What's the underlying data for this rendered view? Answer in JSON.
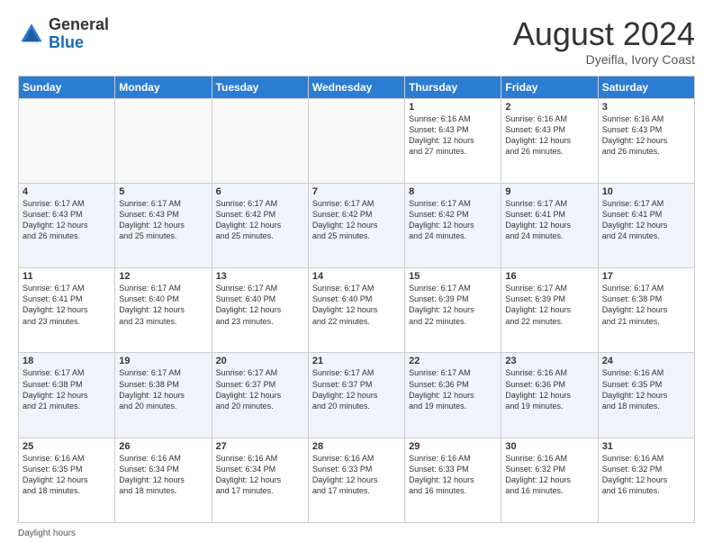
{
  "logo": {
    "line1": "General",
    "line2": "Blue"
  },
  "title": "August 2024",
  "subtitle": "Dyeifla, Ivory Coast",
  "days_of_week": [
    "Sunday",
    "Monday",
    "Tuesday",
    "Wednesday",
    "Thursday",
    "Friday",
    "Saturday"
  ],
  "weeks": [
    [
      {
        "day": "",
        "info": ""
      },
      {
        "day": "",
        "info": ""
      },
      {
        "day": "",
        "info": ""
      },
      {
        "day": "",
        "info": ""
      },
      {
        "day": "1",
        "info": "Sunrise: 6:16 AM\nSunset: 6:43 PM\nDaylight: 12 hours\nand 27 minutes."
      },
      {
        "day": "2",
        "info": "Sunrise: 6:16 AM\nSunset: 6:43 PM\nDaylight: 12 hours\nand 26 minutes."
      },
      {
        "day": "3",
        "info": "Sunrise: 6:16 AM\nSunset: 6:43 PM\nDaylight: 12 hours\nand 26 minutes."
      }
    ],
    [
      {
        "day": "4",
        "info": "Sunrise: 6:17 AM\nSunset: 6:43 PM\nDaylight: 12 hours\nand 26 minutes."
      },
      {
        "day": "5",
        "info": "Sunrise: 6:17 AM\nSunset: 6:43 PM\nDaylight: 12 hours\nand 25 minutes."
      },
      {
        "day": "6",
        "info": "Sunrise: 6:17 AM\nSunset: 6:42 PM\nDaylight: 12 hours\nand 25 minutes."
      },
      {
        "day": "7",
        "info": "Sunrise: 6:17 AM\nSunset: 6:42 PM\nDaylight: 12 hours\nand 25 minutes."
      },
      {
        "day": "8",
        "info": "Sunrise: 6:17 AM\nSunset: 6:42 PM\nDaylight: 12 hours\nand 24 minutes."
      },
      {
        "day": "9",
        "info": "Sunrise: 6:17 AM\nSunset: 6:41 PM\nDaylight: 12 hours\nand 24 minutes."
      },
      {
        "day": "10",
        "info": "Sunrise: 6:17 AM\nSunset: 6:41 PM\nDaylight: 12 hours\nand 24 minutes."
      }
    ],
    [
      {
        "day": "11",
        "info": "Sunrise: 6:17 AM\nSunset: 6:41 PM\nDaylight: 12 hours\nand 23 minutes."
      },
      {
        "day": "12",
        "info": "Sunrise: 6:17 AM\nSunset: 6:40 PM\nDaylight: 12 hours\nand 23 minutes."
      },
      {
        "day": "13",
        "info": "Sunrise: 6:17 AM\nSunset: 6:40 PM\nDaylight: 12 hours\nand 23 minutes."
      },
      {
        "day": "14",
        "info": "Sunrise: 6:17 AM\nSunset: 6:40 PM\nDaylight: 12 hours\nand 22 minutes."
      },
      {
        "day": "15",
        "info": "Sunrise: 6:17 AM\nSunset: 6:39 PM\nDaylight: 12 hours\nand 22 minutes."
      },
      {
        "day": "16",
        "info": "Sunrise: 6:17 AM\nSunset: 6:39 PM\nDaylight: 12 hours\nand 22 minutes."
      },
      {
        "day": "17",
        "info": "Sunrise: 6:17 AM\nSunset: 6:38 PM\nDaylight: 12 hours\nand 21 minutes."
      }
    ],
    [
      {
        "day": "18",
        "info": "Sunrise: 6:17 AM\nSunset: 6:38 PM\nDaylight: 12 hours\nand 21 minutes."
      },
      {
        "day": "19",
        "info": "Sunrise: 6:17 AM\nSunset: 6:38 PM\nDaylight: 12 hours\nand 20 minutes."
      },
      {
        "day": "20",
        "info": "Sunrise: 6:17 AM\nSunset: 6:37 PM\nDaylight: 12 hours\nand 20 minutes."
      },
      {
        "day": "21",
        "info": "Sunrise: 6:17 AM\nSunset: 6:37 PM\nDaylight: 12 hours\nand 20 minutes."
      },
      {
        "day": "22",
        "info": "Sunrise: 6:17 AM\nSunset: 6:36 PM\nDaylight: 12 hours\nand 19 minutes."
      },
      {
        "day": "23",
        "info": "Sunrise: 6:16 AM\nSunset: 6:36 PM\nDaylight: 12 hours\nand 19 minutes."
      },
      {
        "day": "24",
        "info": "Sunrise: 6:16 AM\nSunset: 6:35 PM\nDaylight: 12 hours\nand 18 minutes."
      }
    ],
    [
      {
        "day": "25",
        "info": "Sunrise: 6:16 AM\nSunset: 6:35 PM\nDaylight: 12 hours\nand 18 minutes."
      },
      {
        "day": "26",
        "info": "Sunrise: 6:16 AM\nSunset: 6:34 PM\nDaylight: 12 hours\nand 18 minutes."
      },
      {
        "day": "27",
        "info": "Sunrise: 6:16 AM\nSunset: 6:34 PM\nDaylight: 12 hours\nand 17 minutes."
      },
      {
        "day": "28",
        "info": "Sunrise: 6:16 AM\nSunset: 6:33 PM\nDaylight: 12 hours\nand 17 minutes."
      },
      {
        "day": "29",
        "info": "Sunrise: 6:16 AM\nSunset: 6:33 PM\nDaylight: 12 hours\nand 16 minutes."
      },
      {
        "day": "30",
        "info": "Sunrise: 6:16 AM\nSunset: 6:32 PM\nDaylight: 12 hours\nand 16 minutes."
      },
      {
        "day": "31",
        "info": "Sunrise: 6:16 AM\nSunset: 6:32 PM\nDaylight: 12 hours\nand 16 minutes."
      }
    ]
  ],
  "footer": "Daylight hours"
}
